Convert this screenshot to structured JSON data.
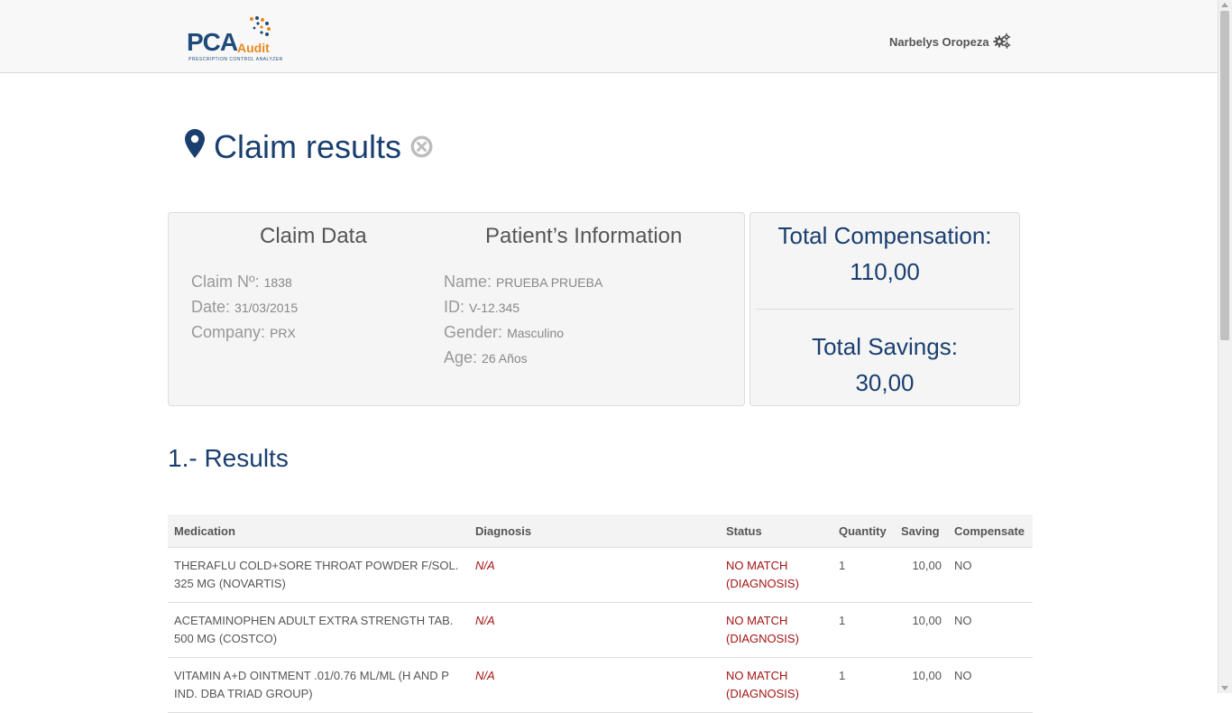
{
  "header": {
    "logo_main": "PCA",
    "logo_sub": "Audit",
    "logo_tagline": "PRESCRIPTION CONTROL ANALYZER",
    "user_name": "Narbelys Oropeza",
    "user_icon": "gears-icon"
  },
  "page": {
    "title": "Claim results",
    "title_icon": "map-marker-icon",
    "close_icon": "close-circle-icon"
  },
  "claim": {
    "heading": "Claim Data",
    "number_label": "Claim Nº:",
    "number": "1838",
    "date_label": "Date:",
    "date": "31/03/2015",
    "company_label": "Company:",
    "company": "PRX"
  },
  "patient": {
    "heading": "Patient’s Information",
    "name_label": "Name:",
    "name": "PRUEBA PRUEBA",
    "id_label": "ID:",
    "id": "V-12.345",
    "gender_label": "Gender:",
    "gender": "Masculino",
    "age_label": "Age:",
    "age": "26 Años"
  },
  "totals": {
    "compensation_label": "Total Compensation:",
    "compensation": "110,00",
    "savings_label": "Total Savings:",
    "savings": "30,00"
  },
  "results": {
    "heading": "1.- Results",
    "columns": [
      "Medication",
      "Diagnosis",
      "Status",
      "Quantity",
      "Saving",
      "Compensate"
    ],
    "rows": [
      {
        "medication_l1": "THERAFLU COLD+SORE THROAT POWDER F/SOL.",
        "medication_l2": "325 MG (NOVARTIS)",
        "diagnosis": "N/A",
        "status_l1": "NO MATCH",
        "status_l2": "(DIAGNOSIS)",
        "quantity": "1",
        "saving": "10,00",
        "compensate": "NO"
      },
      {
        "medication_l1": "ACETAMINOPHEN ADULT EXTRA STRENGTH TAB.",
        "medication_l2": "500 MG (COSTCO)",
        "diagnosis": "N/A",
        "status_l1": "NO MATCH",
        "status_l2": "(DIAGNOSIS)",
        "quantity": "1",
        "saving": "10,00",
        "compensate": "NO"
      },
      {
        "medication_l1": "VITAMIN A+D OINTMENT .01/0.76 ML/ML (H AND P",
        "medication_l2": "IND. DBA TRIAD GROUP)",
        "diagnosis": "N/A",
        "status_l1": "NO MATCH",
        "status_l2": "(DIAGNOSIS)",
        "quantity": "1",
        "saving": "10,00",
        "compensate": "NO"
      }
    ]
  },
  "colors": {
    "brand_blue": "#1a3f6f",
    "brand_orange": "#e8891f",
    "error_red": "#a31515"
  }
}
